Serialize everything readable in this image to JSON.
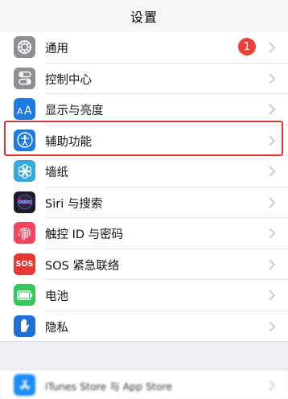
{
  "nav": {
    "title": "设置"
  },
  "settings": [
    {
      "label": "通用",
      "icon": "gear-icon",
      "icon_bg": "#8e8e93",
      "badge": "1"
    },
    {
      "label": "控制中心",
      "icon": "toggle-icon",
      "icon_bg": "#8e8e93"
    },
    {
      "label": "显示与亮度",
      "icon": "text-size-icon",
      "icon_bg": "#1f7ae0"
    },
    {
      "label": "辅助功能",
      "icon": "accessibility-icon",
      "icon_bg": "#1f7ae0",
      "highlighted": true
    },
    {
      "label": "墙纸",
      "icon": "flower-icon",
      "icon_bg": "#35aadc"
    },
    {
      "label": "Siri 与搜索",
      "icon": "siri-icon",
      "icon_bg": "#1c1c28"
    },
    {
      "label": "触控 ID 与密码",
      "icon": "fingerprint-icon",
      "icon_bg": "#f0455a"
    },
    {
      "label": "SOS 紧急联络",
      "icon": "sos-icon",
      "icon_bg": "#e53935",
      "icon_text": "SOS"
    },
    {
      "label": "电池",
      "icon": "battery-icon",
      "icon_bg": "#34c759"
    },
    {
      "label": "隐私",
      "icon": "hand-icon",
      "icon_bg": "#1f6fd6"
    }
  ],
  "second_group": [
    {
      "label": "iTunes Store 与 App Store",
      "icon": "app-store-icon",
      "icon_bg": "#1b8df5"
    }
  ],
  "colors": {
    "highlight_border": "#d9372f",
    "badge": "#e8433a",
    "chevron": "#c7c7cc"
  }
}
